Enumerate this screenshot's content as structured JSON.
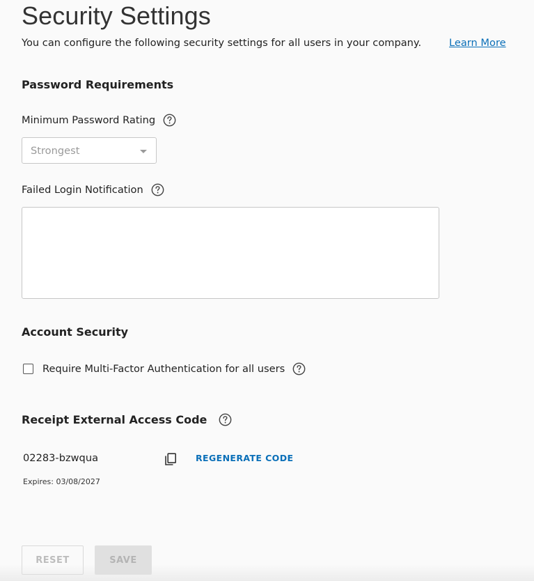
{
  "page": {
    "title": "Security Settings",
    "intro": "You can configure the following security settings for all users in your company.",
    "learn_more": "Learn More"
  },
  "password_requirements": {
    "heading": "Password Requirements",
    "min_rating_label": "Minimum Password Rating",
    "min_rating_value": "Strongest",
    "failed_login_label": "Failed Login Notification",
    "failed_login_value": ""
  },
  "account_security": {
    "heading": "Account Security",
    "mfa_label": "Require Multi-Factor Authentication for all users",
    "mfa_checked": false
  },
  "receipt_access": {
    "heading": "Receipt External Access Code",
    "code": "02283-bzwqua",
    "regenerate_label": "REGENERATE CODE",
    "expires": "Expires: 03/08/2027"
  },
  "actions": {
    "reset_label": "RESET",
    "save_label": "SAVE"
  },
  "icons": {
    "help": "question-circle-icon",
    "copy": "copy-icon",
    "dropdown": "caret-down-icon"
  },
  "colors": {
    "link": "#0a6fb8",
    "disabled_text": "#bdbdbd",
    "disabled_fill": "#e0e0e0"
  }
}
